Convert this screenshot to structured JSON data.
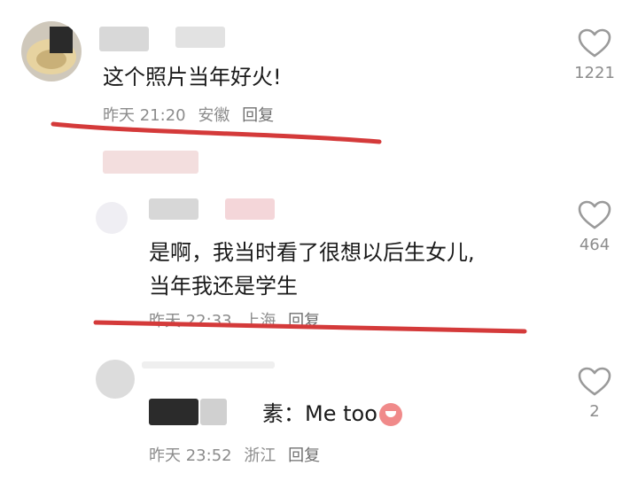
{
  "comments": [
    {
      "text": "这个照片当年好火!",
      "time": "昨天 21:20",
      "location": "安徽",
      "reply": "回复",
      "likes": "1221"
    },
    {
      "text_line1": "是啊，我当时看了很想以后生女儿,",
      "text_line2": "当年我还是学生",
      "time": "昨天 22:33",
      "location": "上海",
      "reply": "回复",
      "likes": "464"
    },
    {
      "prefix": "素：",
      "text": "Me too",
      "time": "昨天 23:52",
      "location": "浙江",
      "reply": "回复",
      "likes": "2"
    }
  ],
  "colors": {
    "underline": "#d43a3a",
    "meta": "#8c8c8c"
  },
  "icons": [
    "heart-outline-icon",
    "laughing-emoji-icon"
  ]
}
